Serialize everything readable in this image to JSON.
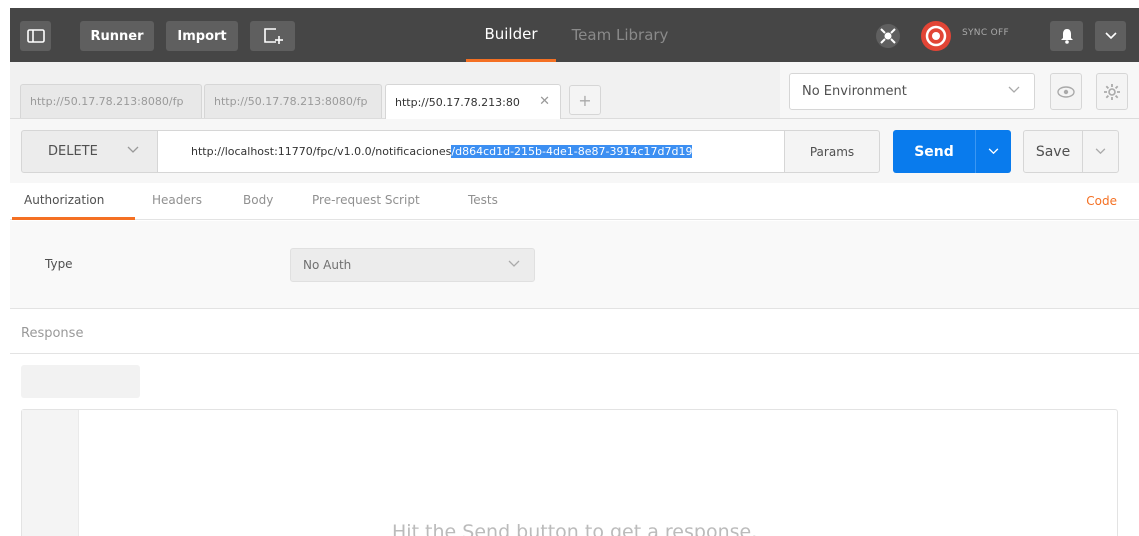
{
  "topbar": {
    "runner_label": "Runner",
    "import_label": "Import",
    "tabs": [
      {
        "label": "Builder",
        "active": true
      },
      {
        "label": "Team Library",
        "active": false
      }
    ],
    "sync_label": "SYNC OFF",
    "accent": "#f47023",
    "sync_color": "#e24536"
  },
  "request_tabs": [
    {
      "label": "http://50.17.78.213:8080/fp",
      "active": false
    },
    {
      "label": "http://50.17.78.213:8080/fp",
      "active": false
    },
    {
      "label": "http://50.17.78.213:80",
      "active": true
    }
  ],
  "add_tab_label": "+",
  "environment": {
    "selected": "No Environment"
  },
  "request": {
    "method": "DELETE",
    "url_base": "http://localhost:11770/fpc/v1.0.0/notificaciones",
    "url_selected": "/d864cd1d-215b-4de1-8e87-3914c17d7d19",
    "params_label": "Params",
    "send_label": "Send",
    "save_label": "Save",
    "send_color": "#097bed"
  },
  "section_tabs": [
    {
      "label": "Authorization",
      "active": true
    },
    {
      "label": "Headers",
      "active": false
    },
    {
      "label": "Body",
      "active": false
    },
    {
      "label": "Pre-request Script",
      "active": false
    },
    {
      "label": "Tests",
      "active": false
    }
  ],
  "code_link": "Code",
  "auth": {
    "type_label": "Type",
    "selected": "No Auth"
  },
  "response": {
    "header": "Response",
    "hint": "Hit the Send button to get a response."
  }
}
